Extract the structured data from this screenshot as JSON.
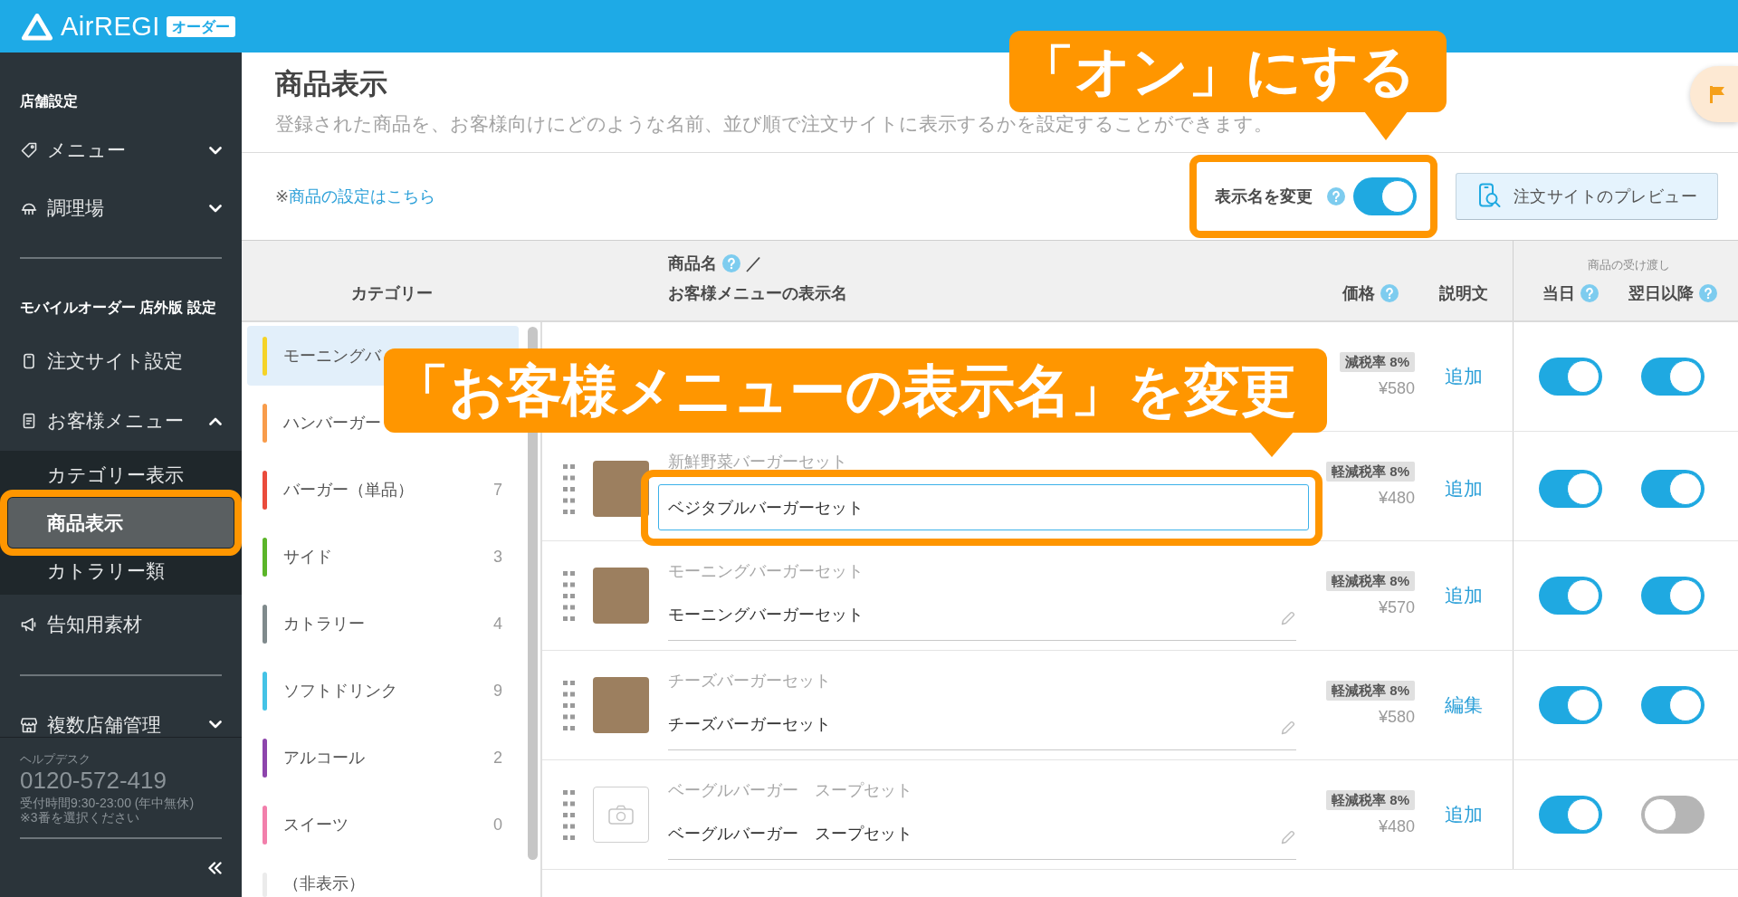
{
  "top_bar": {
    "logo_text": "AirREGI",
    "product_badge": "オーダー"
  },
  "sidebar": {
    "groups": [
      {
        "heading": "店舗設定",
        "items": [
          {
            "label": "メニュー",
            "selected": false,
            "expanded": false
          },
          {
            "label": "調理場",
            "selected": false,
            "expanded": false
          }
        ]
      },
      {
        "heading": "モバイルオーダー 店外版 設定",
        "items": [
          {
            "label": "注文サイト設定",
            "selected": false
          },
          {
            "label": "お客様メニュー",
            "selected": false,
            "expanded": true,
            "children": [
              {
                "label": "カテゴリー表示",
                "selected": false,
                "highlighted": false
              },
              {
                "label": "商品表示",
                "selected": true,
                "highlighted": true
              },
              {
                "label": "カトラリー類",
                "selected": false,
                "highlighted": false
              }
            ]
          },
          {
            "label": "告知用素材",
            "selected": false
          }
        ]
      },
      {
        "items": [
          {
            "label": "複数店舗管理",
            "selected": false,
            "expanded": false
          }
        ]
      }
    ],
    "help_desk": {
      "title": "ヘルプデスク",
      "phone": "0120-572-419",
      "hours": "受付時間9:30-23:00 (年中無休)",
      "note": "※3番を選択ください"
    }
  },
  "page": {
    "title": "商品表示",
    "description": "登録された商品を、お客様向けにどのような名前、並び順で注文サイトに表示するかを設定することができます。"
  },
  "toolbar": {
    "note_mark": "※",
    "settings_link": "商品の設定はこちら",
    "display_name_switch": {
      "label": "表示名を変更",
      "help": true,
      "on": true,
      "highlighted": true
    },
    "preview_button": "注文サイトのプレビュー"
  },
  "table": {
    "headers": {
      "category": "カテゴリー",
      "name": {
        "label": "商品名",
        "help": true,
        "separator": "／",
        "display_label": "お客様メニューの表示名"
      },
      "price": {
        "label": "価格",
        "help": true
      },
      "description": {
        "label": "説明文"
      },
      "delivery": {
        "label": "商品の受け渡し",
        "same_day": {
          "label": "当日",
          "help": true
        },
        "next_day": {
          "label": "翌日以降",
          "help": true
        }
      }
    },
    "categories": [
      {
        "name": "モーニングバ",
        "color": "#f5d327",
        "selected": true
      },
      {
        "name": "ハンバーガー",
        "color": "#f89c4b",
        "selected": false
      },
      {
        "name": "バーガー（単品）",
        "count": "7",
        "color": "#ea4b3c",
        "selected": false
      },
      {
        "name": "サイド",
        "count": "3",
        "color": "#5bb529",
        "selected": false
      },
      {
        "name": "カトラリー",
        "count": "4",
        "color": "#7f8a8c",
        "selected": false
      },
      {
        "name": "ソフトドリンク",
        "count": "9",
        "color": "#44c3e6",
        "selected": false
      },
      {
        "name": "アルコール",
        "count": "2",
        "color": "#8d45ac",
        "selected": false
      },
      {
        "name": "スイーツ",
        "count": "0",
        "color": "#f27fab",
        "selected": false
      },
      {
        "name": "（非表示）",
        "color": "#ebebeb",
        "selected": false
      }
    ],
    "products": [
      {
        "kind": "partial",
        "tax_tag": "減税率 8%",
        "price": "¥580",
        "description_action": "追加",
        "same_day": true,
        "next_day": true
      },
      {
        "kind": "full",
        "thumbnail": {
          "kind": "photo"
        },
        "name": "新鮮野菜バーガーセット",
        "display_name": "ベジタブルバーガーセット",
        "editing": true,
        "highlighted": true,
        "tax_tag": "軽減税率 8%",
        "price": "¥480",
        "description_action": "追加",
        "same_day": true,
        "next_day": true
      },
      {
        "kind": "full",
        "thumbnail": {
          "kind": "photo"
        },
        "name": "モーニングバーガーセット",
        "display_name": "モーニングバーガーセット",
        "editing": false,
        "highlighted": false,
        "tax_tag": "軽減税率 8%",
        "price": "¥570",
        "description_action": "追加",
        "same_day": true,
        "next_day": true
      },
      {
        "kind": "full",
        "thumbnail": {
          "kind": "photo"
        },
        "name": "チーズバーガーセット",
        "display_name": "チーズバーガーセット",
        "editing": false,
        "highlighted": false,
        "tax_tag": "軽減税率 8%",
        "price": "¥580",
        "description_action": "編集",
        "same_day": true,
        "next_day": true
      },
      {
        "kind": "full",
        "thumbnail": {
          "kind": "placeholder"
        },
        "name": "ベーグルバーガー　スープセット",
        "display_name": "ベーグルバーガー　スープセット",
        "editing": false,
        "highlighted": false,
        "tax_tag": "軽減税率 8%",
        "price": "¥480",
        "description_action": "追加",
        "same_day": true,
        "next_day": false
      }
    ]
  },
  "callouts": [
    {
      "text": "「オン」にする"
    },
    {
      "text": "「お客様メニューの表示名」を変更"
    }
  ]
}
